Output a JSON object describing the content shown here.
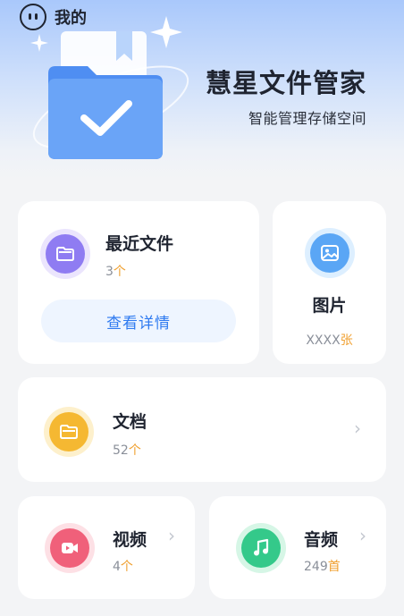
{
  "header": {
    "mine_label": "我的",
    "app_title": "慧星文件管家",
    "app_subtitle": "智能管理存储空间"
  },
  "recent": {
    "title": "最近文件",
    "count_value": "3",
    "count_unit": "个",
    "button_label": "查看详情"
  },
  "images": {
    "title": "图片",
    "count_value": "XXXX",
    "count_unit": "张"
  },
  "documents": {
    "title": "文档",
    "count_value": "52",
    "count_unit": "个"
  },
  "video": {
    "title": "视频",
    "count_value": "4",
    "count_unit": "个"
  },
  "audio": {
    "title": "音频",
    "count_value": "249",
    "count_unit": "首"
  },
  "colors": {
    "accent_blue": "#2e7af0",
    "count_unit_orange": "#f0a030",
    "recent_icon": "#8f7cf2",
    "images_icon": "#5aa6f5",
    "documents_icon": "#f5b832",
    "video_icon": "#f0607a",
    "audio_icon": "#34c98a"
  }
}
